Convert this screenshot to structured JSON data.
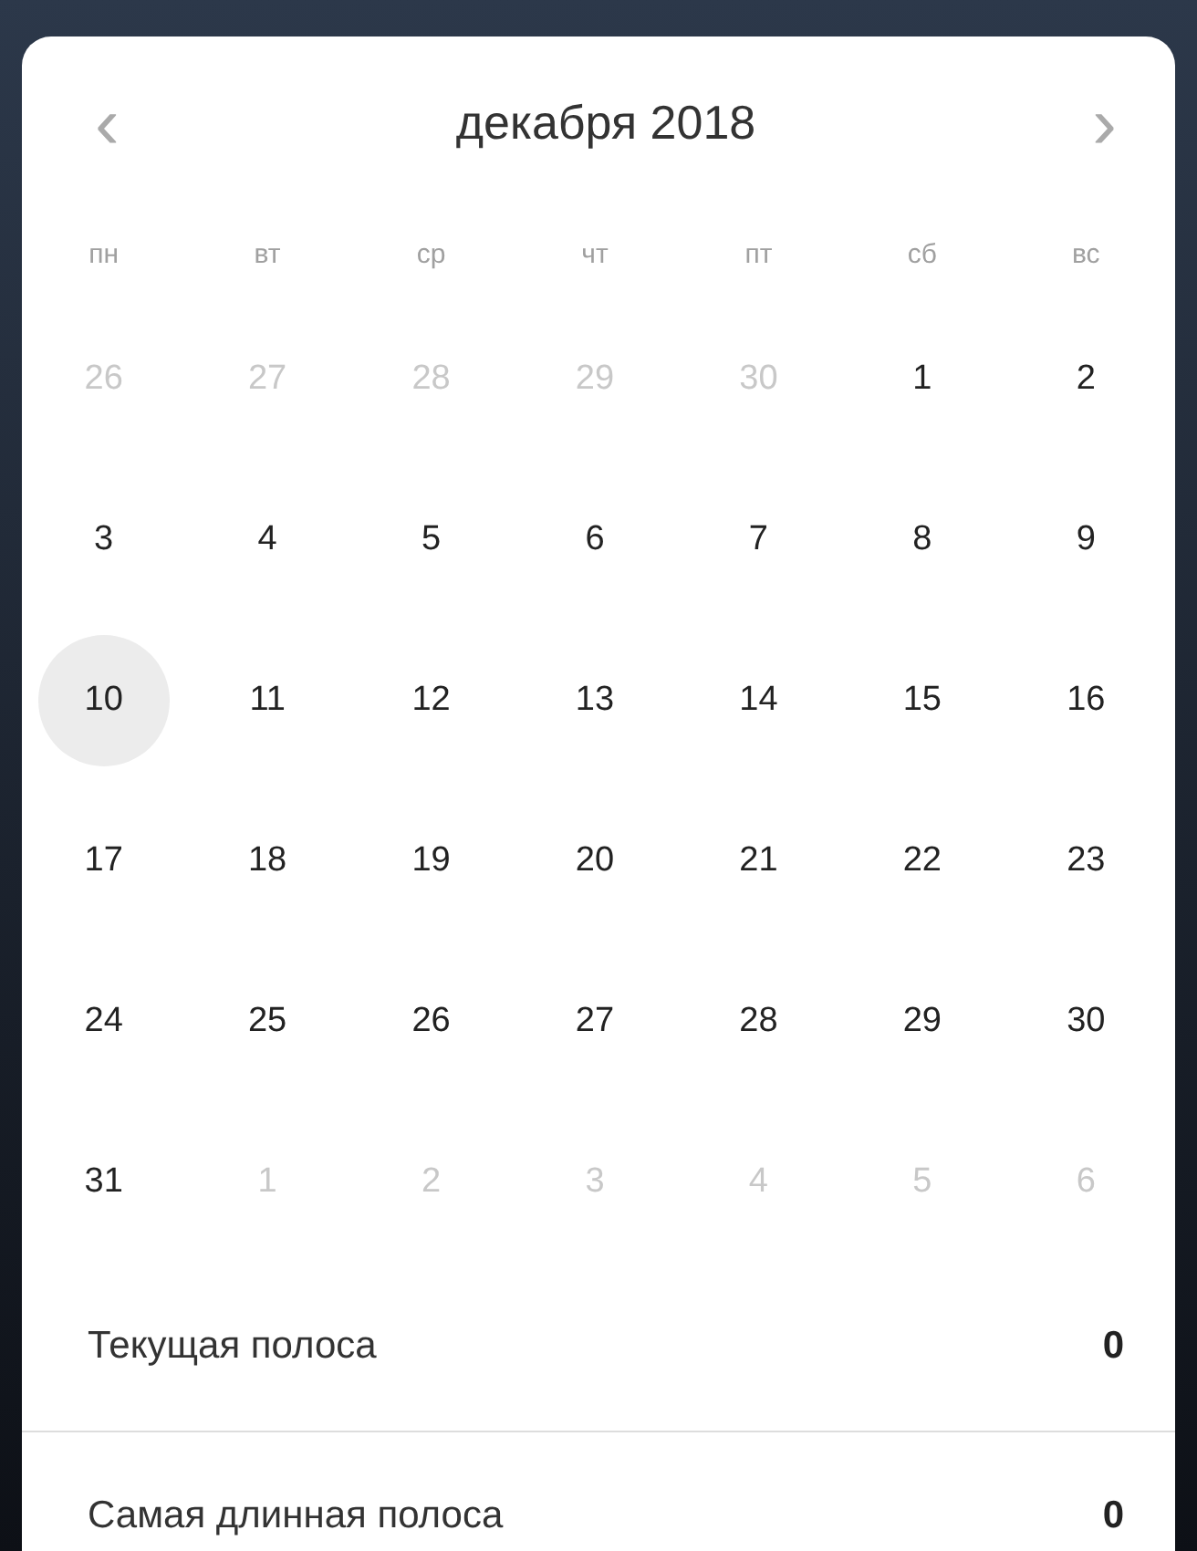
{
  "calendar": {
    "prev": "‹",
    "title": "декабря 2018",
    "next": "›",
    "weekdays": [
      "пн",
      "вт",
      "ср",
      "чт",
      "пт",
      "сб",
      "вс"
    ],
    "days": [
      {
        "label": "26",
        "muted": true,
        "selected": false
      },
      {
        "label": "27",
        "muted": true,
        "selected": false
      },
      {
        "label": "28",
        "muted": true,
        "selected": false
      },
      {
        "label": "29",
        "muted": true,
        "selected": false
      },
      {
        "label": "30",
        "muted": true,
        "selected": false
      },
      {
        "label": "1",
        "muted": false,
        "selected": false
      },
      {
        "label": "2",
        "muted": false,
        "selected": false
      },
      {
        "label": "3",
        "muted": false,
        "selected": false
      },
      {
        "label": "4",
        "muted": false,
        "selected": false
      },
      {
        "label": "5",
        "muted": false,
        "selected": false
      },
      {
        "label": "6",
        "muted": false,
        "selected": false
      },
      {
        "label": "7",
        "muted": false,
        "selected": false
      },
      {
        "label": "8",
        "muted": false,
        "selected": false
      },
      {
        "label": "9",
        "muted": false,
        "selected": false
      },
      {
        "label": "10",
        "muted": false,
        "selected": true
      },
      {
        "label": "11",
        "muted": false,
        "selected": false
      },
      {
        "label": "12",
        "muted": false,
        "selected": false
      },
      {
        "label": "13",
        "muted": false,
        "selected": false
      },
      {
        "label": "14",
        "muted": false,
        "selected": false
      },
      {
        "label": "15",
        "muted": false,
        "selected": false
      },
      {
        "label": "16",
        "muted": false,
        "selected": false
      },
      {
        "label": "17",
        "muted": false,
        "selected": false
      },
      {
        "label": "18",
        "muted": false,
        "selected": false
      },
      {
        "label": "19",
        "muted": false,
        "selected": false
      },
      {
        "label": "20",
        "muted": false,
        "selected": false
      },
      {
        "label": "21",
        "muted": false,
        "selected": false
      },
      {
        "label": "22",
        "muted": false,
        "selected": false
      },
      {
        "label": "23",
        "muted": false,
        "selected": false
      },
      {
        "label": "24",
        "muted": false,
        "selected": false
      },
      {
        "label": "25",
        "muted": false,
        "selected": false
      },
      {
        "label": "26",
        "muted": false,
        "selected": false
      },
      {
        "label": "27",
        "muted": false,
        "selected": false
      },
      {
        "label": "28",
        "muted": false,
        "selected": false
      },
      {
        "label": "29",
        "muted": false,
        "selected": false
      },
      {
        "label": "30",
        "muted": false,
        "selected": false
      },
      {
        "label": "31",
        "muted": false,
        "selected": false
      },
      {
        "label": "1",
        "muted": true,
        "selected": false
      },
      {
        "label": "2",
        "muted": true,
        "selected": false
      },
      {
        "label": "3",
        "muted": true,
        "selected": false
      },
      {
        "label": "4",
        "muted": true,
        "selected": false
      },
      {
        "label": "5",
        "muted": true,
        "selected": false
      },
      {
        "label": "6",
        "muted": true,
        "selected": false
      }
    ]
  },
  "stats": [
    {
      "label": "Текущая полоса",
      "value": "0"
    },
    {
      "label": "Самая длинная полоса",
      "value": "0"
    }
  ]
}
